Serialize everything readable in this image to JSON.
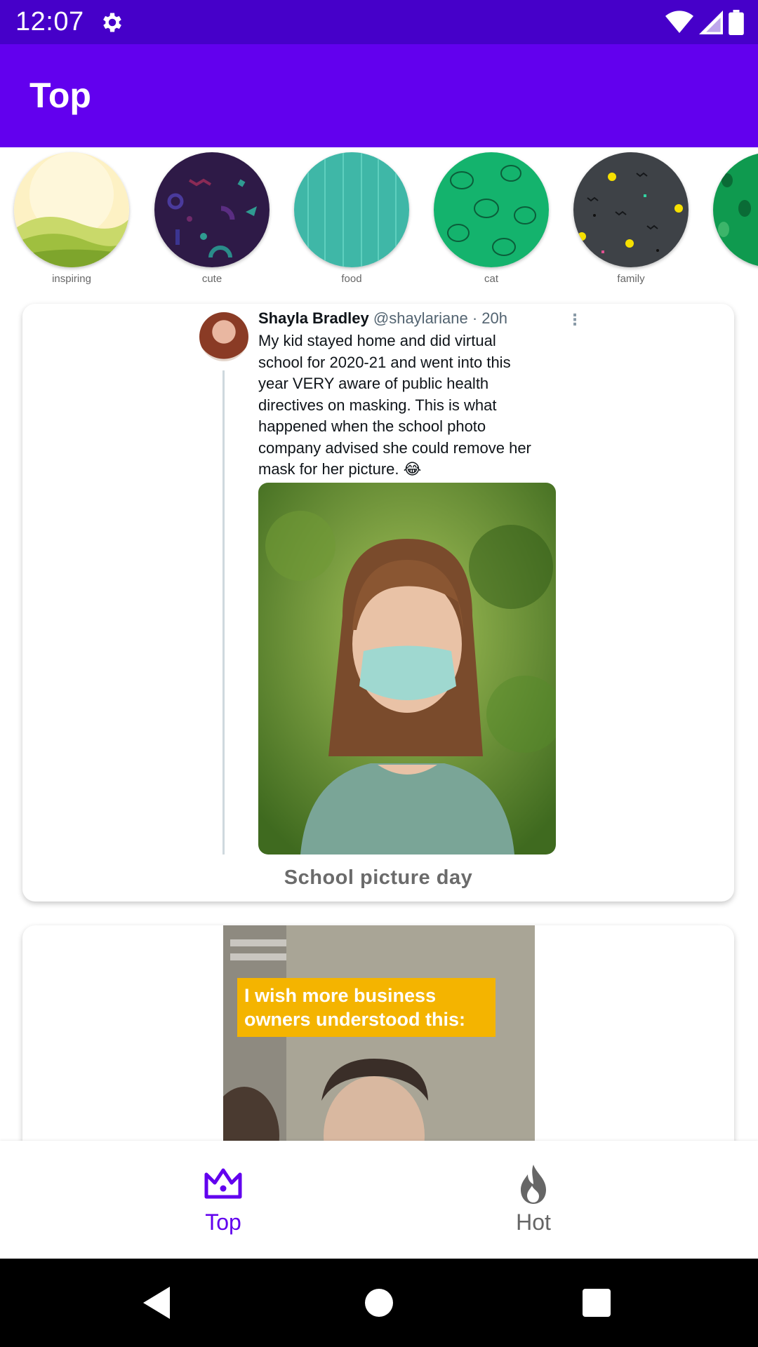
{
  "status_bar": {
    "time": "12:07",
    "icons": [
      "gear-icon",
      "wifi-icon",
      "signal-icon",
      "battery-icon"
    ]
  },
  "app_bar": {
    "title": "Top"
  },
  "categories": [
    {
      "label": "inspiring"
    },
    {
      "label": "cute"
    },
    {
      "label": "food"
    },
    {
      "label": "cat"
    },
    {
      "label": "family"
    }
  ],
  "posts": [
    {
      "tweet": {
        "name": "Shayla Bradley",
        "handle": "@shaylariane",
        "time": "· 20h",
        "text_lines": [
          "My kid stayed home and did virtual",
          "school for 2020-21 and went into this",
          "year VERY aware of public health",
          "directives on masking. This is what",
          "happened when the school photo",
          "company advised she could remove her",
          "mask for her picture. 😂"
        ]
      },
      "title": "School picture day"
    },
    {
      "meme_caption_lines": [
        "I wish more business",
        "owners understood this:"
      ]
    }
  ],
  "bottom_nav": {
    "items": [
      {
        "label": "Top",
        "icon": "crown-icon",
        "selected": true
      },
      {
        "label": "Hot",
        "icon": "fire-icon",
        "selected": false
      }
    ]
  },
  "colors": {
    "status_bar": "#4600c9",
    "primary": "#6200ee",
    "nav_inactive": "#666666"
  }
}
